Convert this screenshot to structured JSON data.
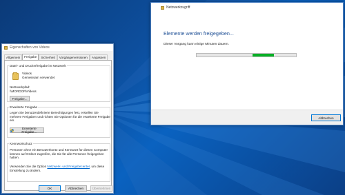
{
  "properties_dialog": {
    "title": "Eigenschaften von Videos",
    "tabs": [
      "Allgemein",
      "Freigabe",
      "Sicherheit",
      "Vorgängerversionen",
      "Anpassen"
    ],
    "active_tab": "Freigabe",
    "sharing_group": {
      "title": "Datei- und Druckerfreigabe im Netzwerk",
      "item_name": "Videos",
      "item_status": "Gemeinsam verwendet",
      "path_label": "Netzwerkpfad:",
      "path_value": "\\\\MORDOR\\Videos",
      "share_button": "Freigabe..."
    },
    "advanced_group": {
      "title": "Erweiterte Freigabe",
      "description": "Legen Sie benutzerdefinierte Berechtigungen fest, erstellen Sie mehrere Freigaben und richten Sie Optionen für die erweiterte Freigabe ein.",
      "button": "Erweiterte Freigabe..."
    },
    "password_group": {
      "title": "Kennwortschutz",
      "description": "Personen ohne ein Benutzerkonto und Kennwort für diesen Computer können auf Ordner zugreifen, die Sie für alle Personen freigegeben haben.",
      "change_prefix": "Verwenden Sie die Option ",
      "change_link": "Netzwerk- und Freigabecenter",
      "change_suffix": ", um diese Einstellung zu ändern."
    },
    "buttons": {
      "ok": "OK",
      "cancel": "Abbrechen",
      "apply": "Übernehmen"
    }
  },
  "network_dialog": {
    "title": "Netzwerkzugriff",
    "heading": "Elemente werden freigegeben...",
    "description": "Dieser Vorgang kann einige Minuten dauern.",
    "progress": 0.78,
    "cancel_button": "Abbrechen"
  },
  "colors": {
    "progress_green": "#06b025",
    "heading_blue": "#1e4f95",
    "desktop_blue": "#0d4f9e"
  }
}
